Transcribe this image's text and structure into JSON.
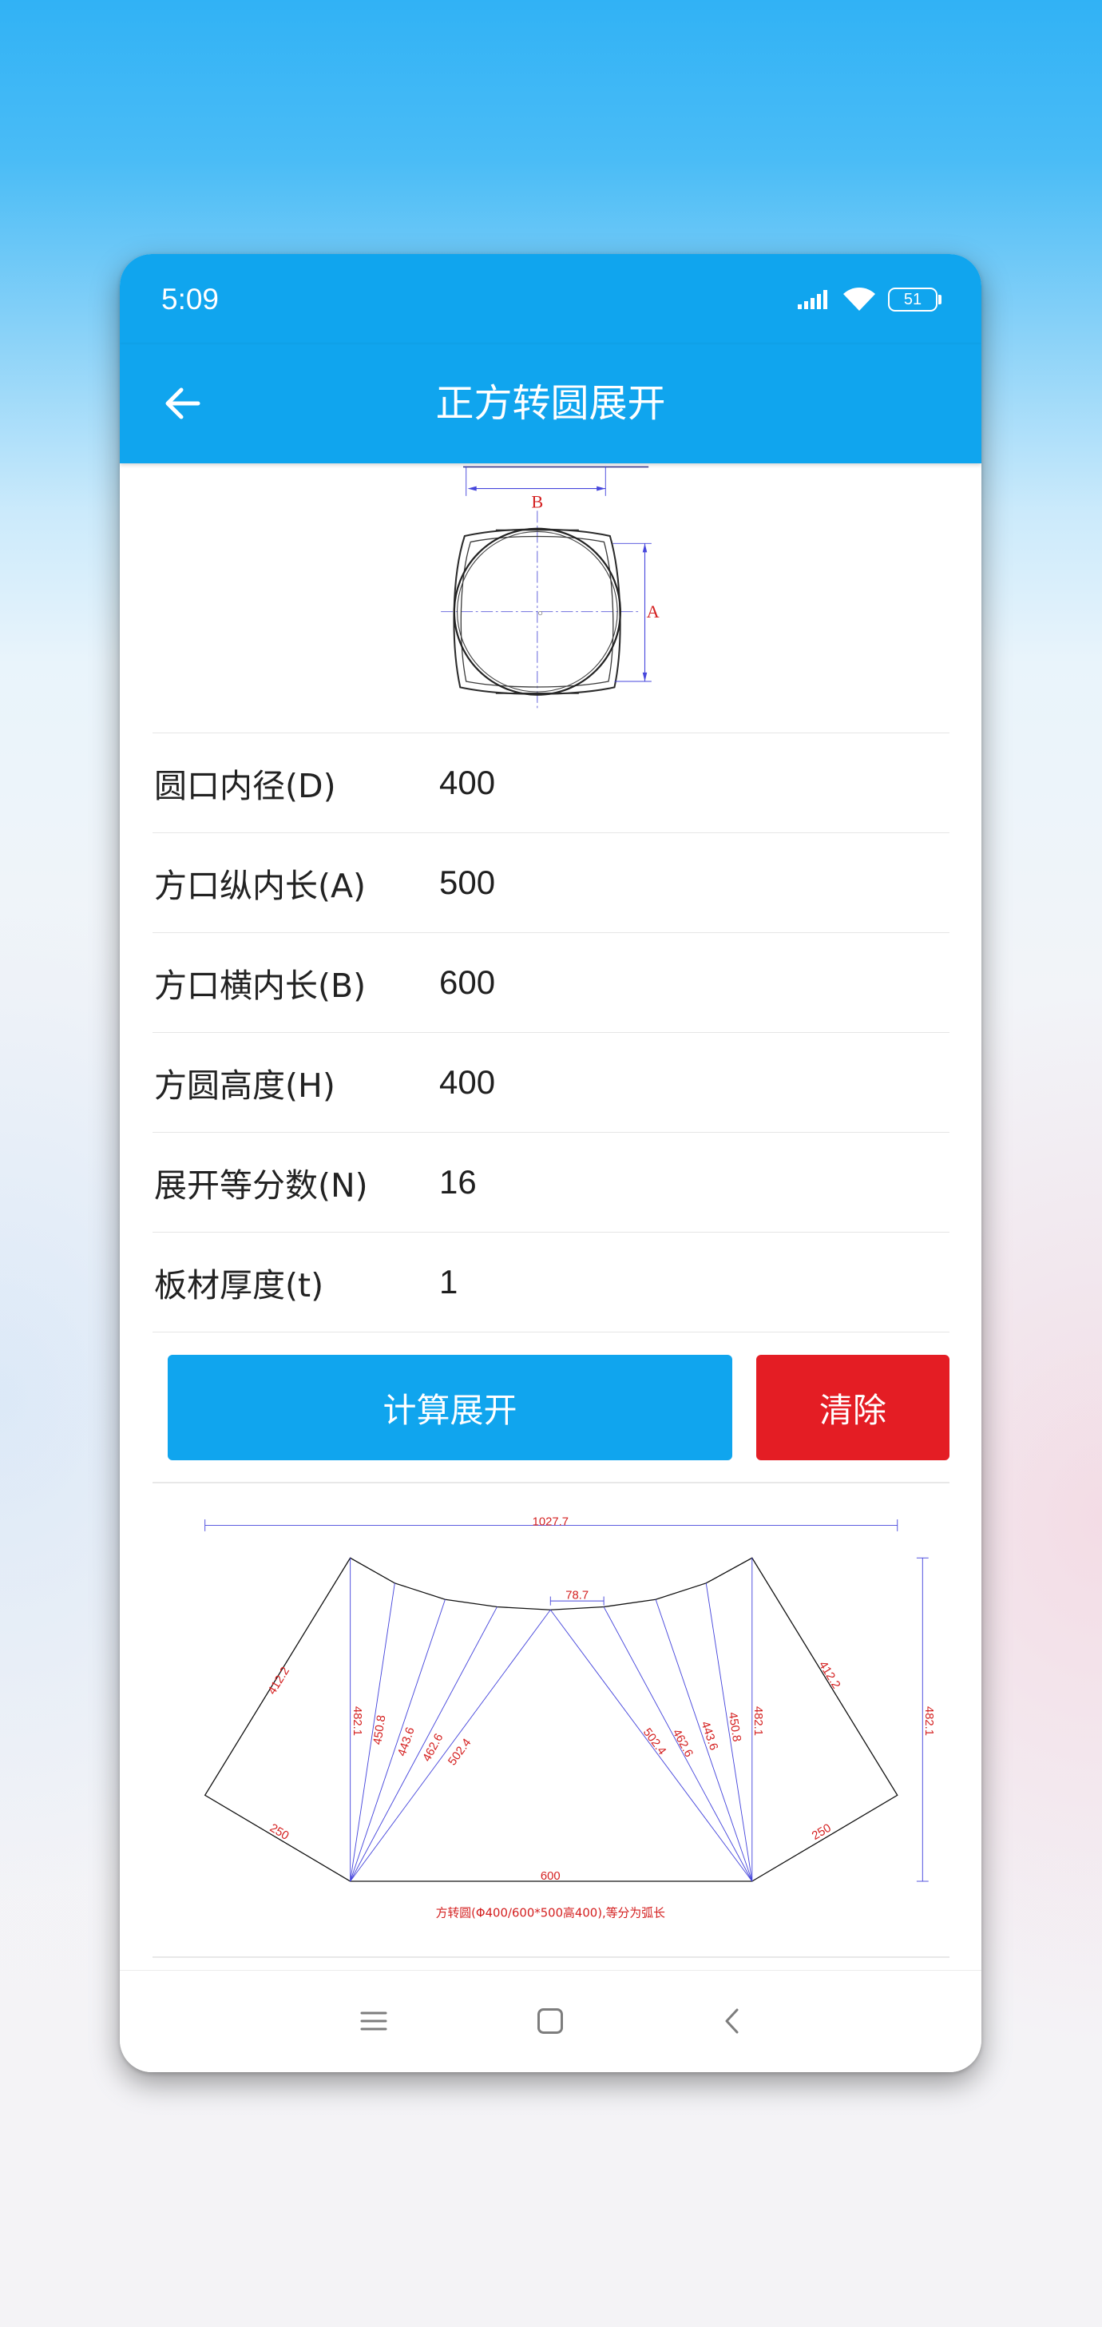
{
  "status_bar": {
    "time": "5:09",
    "battery_level": "51",
    "icons": [
      "signal-icon",
      "wifi-icon",
      "battery-icon"
    ]
  },
  "header": {
    "title": "正方转圆展开",
    "back_icon": "arrow-left-icon"
  },
  "section_diagram": {
    "label_b": "B",
    "label_a": "A"
  },
  "form": {
    "rows": [
      {
        "label": "圆口内径(D)",
        "value": "400"
      },
      {
        "label": "方口纵内长(A)",
        "value": "500"
      },
      {
        "label": "方口横内长(B)",
        "value": "600"
      },
      {
        "label": "方圆高度(H)",
        "value": "400"
      },
      {
        "label": "展开等分数(N)",
        "value": "16"
      },
      {
        "label": "板材厚度(t)",
        "value": "1"
      }
    ]
  },
  "actions": {
    "calculate": "计算展开",
    "clear": "清除"
  },
  "unfold_drawing": {
    "overall_width": "1027.7",
    "arc_chord": "78.7",
    "base": "600",
    "height": "482.1",
    "left_side": "412.2",
    "right_side": "412.2",
    "left_bottom": "250",
    "right_bottom": "250",
    "left_lines": [
      "482.1",
      "450.8",
      "443.6",
      "462.6",
      "502.4"
    ],
    "right_lines": [
      "502.4",
      "462.6",
      "443.6",
      "450.8",
      "482.1"
    ],
    "caption": "方转圆(Φ400/600*500高400),等分为弧长"
  },
  "nav_bar": {
    "icons": [
      "menu-icon",
      "home-icon",
      "chevron-left-icon"
    ]
  },
  "colors": {
    "primary": "#10a5ee",
    "danger": "#e41d24",
    "drawing_text": "#d42020",
    "drawing_lines": "#4646dc"
  }
}
